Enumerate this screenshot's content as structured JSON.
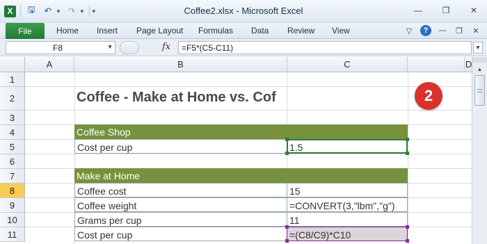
{
  "window": {
    "title": "Coffee2.xlsx - Microsoft Excel",
    "app_icon_letter": "X"
  },
  "ribbon": {
    "file_tab": "File",
    "tabs": [
      "Home",
      "Insert",
      "Page Layout",
      "Formulas",
      "Data",
      "Review",
      "View"
    ]
  },
  "formula_bar": {
    "name_box": "F8",
    "fx_label": "fx",
    "formula": "=F5*(C5-C11)"
  },
  "columns": [
    "A",
    "B",
    "C",
    "D"
  ],
  "rows": [
    "1",
    "2",
    "3",
    "4",
    "5",
    "6",
    "7",
    "8",
    "9",
    "10",
    "11"
  ],
  "sheet": {
    "title": "Coffee - Make at Home vs. Cof",
    "coffee_shop": {
      "header": "Coffee Shop",
      "cost_label": "Cost per cup",
      "cost_value": "1.5"
    },
    "make_at_home": {
      "header": "Make at Home",
      "rows": [
        {
          "label": "Coffee cost",
          "value": "15"
        },
        {
          "label": "Coffee weight",
          "value": "=CONVERT(3,\"lbm\",\"g\")"
        },
        {
          "label": "Grams per cup",
          "value": "11"
        },
        {
          "label": "Cost per cup",
          "value": "=(C8/C9)*C10"
        }
      ]
    }
  },
  "badge": "2",
  "colors": {
    "section_header": "#76923c",
    "active_row": "#f7cd54",
    "badge": "#d8312e",
    "file_tab": "#217a34"
  }
}
